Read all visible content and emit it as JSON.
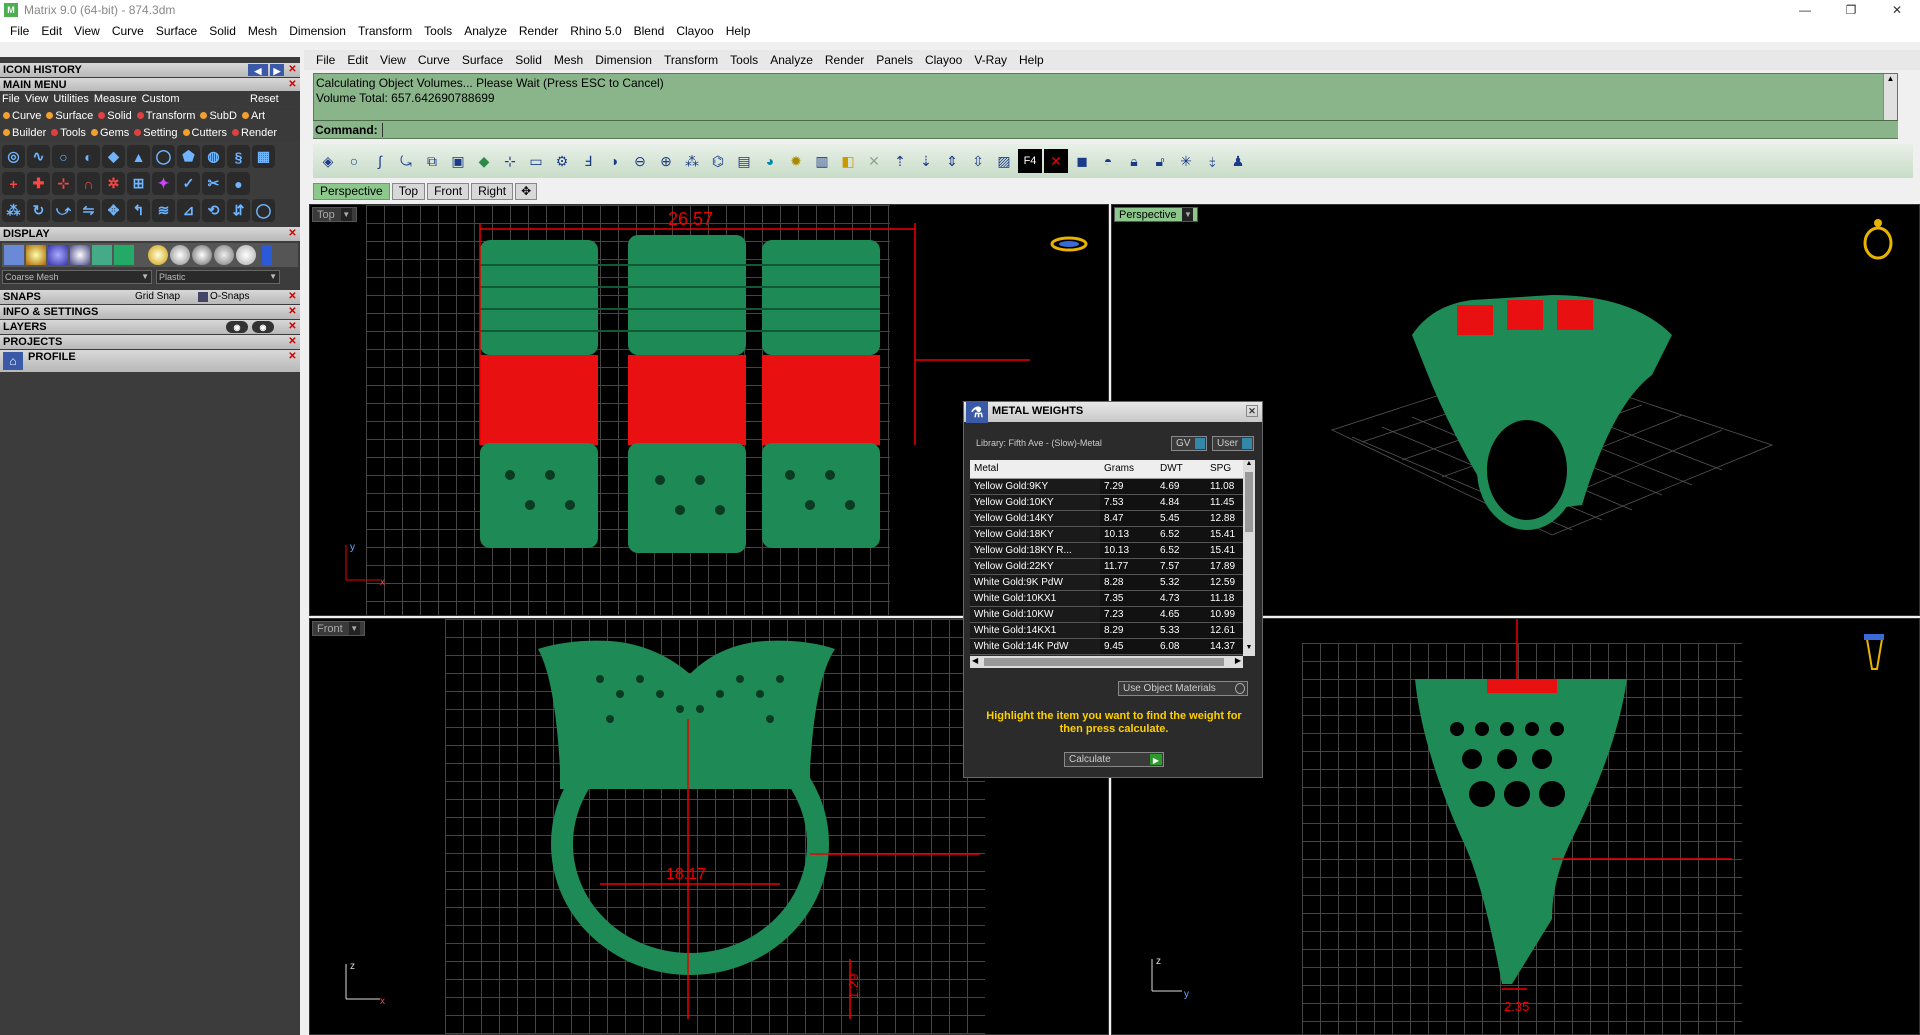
{
  "window": {
    "title": "Matrix 9.0 (64-bit) - 874.3dm",
    "logo_text": "M"
  },
  "outer_menu": [
    "File",
    "Edit",
    "View",
    "Curve",
    "Surface",
    "Solid",
    "Mesh",
    "Dimension",
    "Transform",
    "Tools",
    "Analyze",
    "Render",
    "Rhino 5.0",
    "Blend",
    "Clayoo",
    "Help"
  ],
  "left_panel": {
    "icon_history": "ICON HISTORY",
    "main_menu": "MAIN MENU",
    "submenu": [
      "File",
      "View",
      "Utilities",
      "Measure",
      "Custom"
    ],
    "reset": "Reset",
    "row1": [
      {
        "label": "Curve",
        "color": "#f0a030"
      },
      {
        "label": "Surface",
        "color": "#f0a030"
      },
      {
        "label": "Solid",
        "color": "#e04040"
      },
      {
        "label": "Transform",
        "color": "#e04040"
      },
      {
        "label": "SubD",
        "color": "#f0a030"
      },
      {
        "label": "Art",
        "color": "#f0a030"
      }
    ],
    "row2": [
      {
        "label": "Builder",
        "color": "#f0a030"
      },
      {
        "label": "Tools",
        "color": "#e04040"
      },
      {
        "label": "Gems",
        "color": "#f0a030"
      },
      {
        "label": "Setting",
        "color": "#e04040"
      },
      {
        "label": "Cutters",
        "color": "#f0a030"
      },
      {
        "label": "Render",
        "color": "#e04040"
      }
    ],
    "display": "DISPLAY",
    "mesh_select": "Coarse Mesh",
    "material_select": "Plastic",
    "snaps": "SNAPS",
    "grid_snap": "Grid Snap",
    "o_snaps": "O-Snaps",
    "info_settings": "INFO & SETTINGS",
    "layers": "LAYERS",
    "projects": "PROJECTS",
    "profile": "PROFILE"
  },
  "inner_menu": [
    "File",
    "Edit",
    "View",
    "Curve",
    "Surface",
    "Solid",
    "Mesh",
    "Dimension",
    "Transform",
    "Tools",
    "Analyze",
    "Render",
    "Panels",
    "Clayoo",
    "V-Ray",
    "Help"
  ],
  "command": {
    "line1": "Calculating Object Volumes... Please Wait (Press ESC to Cancel)",
    "line2": "Volume Total: 657.642690788699",
    "label": "Command:"
  },
  "viewport_tabs": [
    "Perspective",
    "Top",
    "Front",
    "Right"
  ],
  "viewports": {
    "top": {
      "label": "Top",
      "dimension": "26.57"
    },
    "perspective": {
      "label": "Perspective"
    },
    "front": {
      "label": "Front",
      "dim_width": "18.17",
      "dim_height": "1.29"
    },
    "right": {
      "dim": "2.35"
    }
  },
  "axes": {
    "x": "x",
    "y": "y",
    "z": "z"
  },
  "metal_weights": {
    "title": "METAL WEIGHTS",
    "library": "Library: Fifth Ave - (Slow)-Metal",
    "gv": "GV",
    "user": "User",
    "columns": [
      "Metal",
      "Grams",
      "DWT",
      "SPG"
    ],
    "rows": [
      [
        "Yellow Gold:9KY",
        "7.29",
        "4.69",
        "11.08"
      ],
      [
        "Yellow Gold:10KY",
        "7.53",
        "4.84",
        "11.45"
      ],
      [
        "Yellow Gold:14KY",
        "8.47",
        "5.45",
        "12.88"
      ],
      [
        "Yellow Gold:18KY",
        "10.13",
        "6.52",
        "15.41"
      ],
      [
        "Yellow Gold:18KY R...",
        "10.13",
        "6.52",
        "15.41"
      ],
      [
        "Yellow Gold:22KY",
        "11.77",
        "7.57",
        "17.89"
      ],
      [
        "White Gold:9K PdW",
        "8.28",
        "5.32",
        "12.59"
      ],
      [
        "White Gold:10KX1",
        "7.35",
        "4.73",
        "11.18"
      ],
      [
        "White Gold:10KW",
        "7.23",
        "4.65",
        "10.99"
      ],
      [
        "White Gold:14KX1",
        "8.29",
        "5.33",
        "12.61"
      ],
      [
        "White Gold:14K PdW",
        "9.45",
        "6.08",
        "14.37"
      ]
    ],
    "use_object_materials": "Use Object Materials",
    "hint": "Highlight the item you want to find the weight for then press calculate.",
    "calculate": "Calculate"
  }
}
